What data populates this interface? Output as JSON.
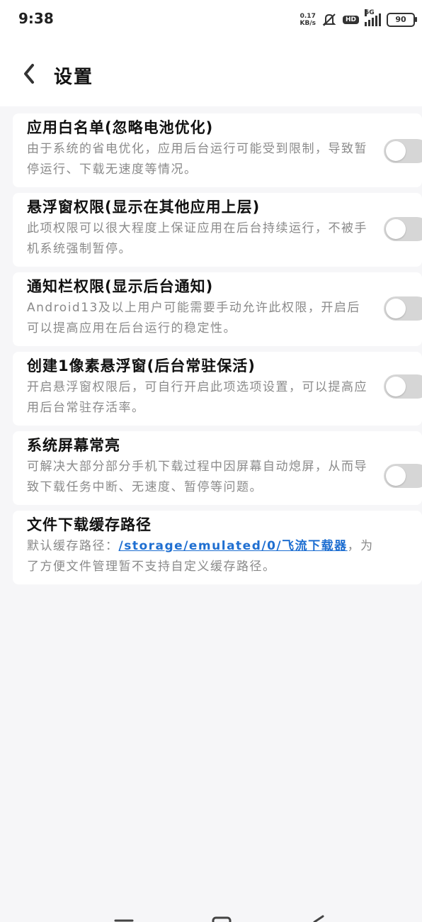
{
  "status_bar": {
    "time": "9:38",
    "net_speed_value": "0.17",
    "net_speed_unit": "KB/s",
    "hd": "HD",
    "network": "5G",
    "battery": "90"
  },
  "header": {
    "title": "设置"
  },
  "settings": [
    {
      "title": "应用白名单(忽略电池优化)",
      "description": "由于系统的省电优化，应用后台运行可能受到限制，导致暂停运行、下载无速度等情况。",
      "enabled": false
    },
    {
      "title": "悬浮窗权限(显示在其他应用上层)",
      "description": "此项权限可以很大程度上保证应用在后台持续运行，不被手机系统强制暂停。",
      "enabled": false
    },
    {
      "title": "通知栏权限(显示后台通知)",
      "description": "Android13及以上用户可能需要手动允许此权限，开启后可以提高应用在后台运行的稳定性。",
      "enabled": false
    },
    {
      "title": "创建1像素悬浮窗(后台常驻保活)",
      "description": "开启悬浮窗权限后，可自行开启此项选项设置，可以提高应用后台常驻存活率。",
      "enabled": false
    },
    {
      "title": "系统屏幕常亮",
      "description": "可解决大部分部分手机下载过程中因屏幕自动熄屏，从而导致下载任务中断、无速度、暂停等问题。",
      "enabled": false
    }
  ],
  "cache_path": {
    "title": "文件下载缓存路径",
    "prefix": "默认缓存路径：",
    "path": "/storage/emulated/0/飞流下载器",
    "suffix": "，为了方便文件管理暂不支持自定义缓存路径。"
  },
  "colors": {
    "link": "#1f6fd1",
    "toggle_off": "#d6d6d6",
    "background": "#f6f6f8"
  }
}
